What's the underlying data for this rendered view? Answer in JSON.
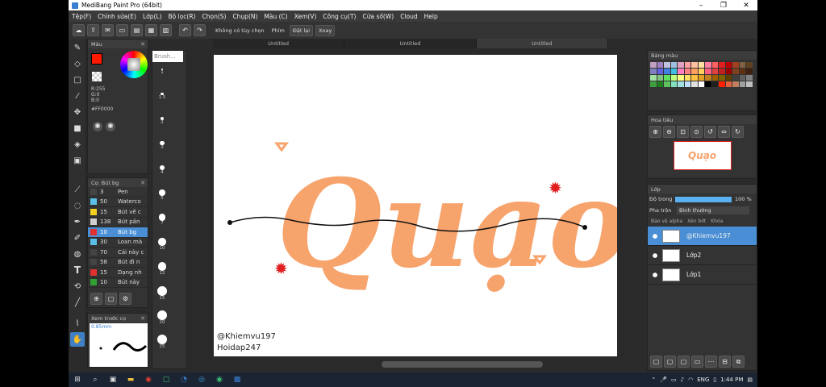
{
  "window": {
    "title": "MediBang Paint Pro (64bit)"
  },
  "menu": [
    "Tệp(F)",
    "Chỉnh sửa(E)",
    "Lớp(L)",
    "Bộ lọc(R)",
    "Chọn(S)",
    "Chụp(N)",
    "Màu (C)",
    "Xem(V)",
    "Công cụ(T)",
    "Cửa số(W)",
    "Cloud",
    "Help"
  ],
  "toolbar": {
    "options_label": "Không có tùy chọn",
    "key_label": "Phím",
    "reset_label": "Đặt lại",
    "rotate_label": "Xoay"
  },
  "tabs": [
    "Untitled",
    "Untitled",
    "Untitled"
  ],
  "color_panel": {
    "title": "Màu",
    "r": "R:255",
    "g": "G:0",
    "b": "B:0",
    "hex": "#FF0000",
    "primary": "#ff1a00",
    "secondary": "#ffffff"
  },
  "brush_panel": {
    "title": "Cọ: Bút bg",
    "items": [
      {
        "size": "3",
        "name": "Pen",
        "color": "#444444"
      },
      {
        "size": "50",
        "name": "Waterco",
        "color": "#5bc0e8"
      },
      {
        "size": "15",
        "name": "Bút vẽ c",
        "color": "#f0d020"
      },
      {
        "size": "138",
        "name": "Bút pấn",
        "color": "#d0d0d0"
      },
      {
        "size": "10",
        "name": "Bút bg",
        "color": "#e03030",
        "selected": true
      },
      {
        "size": "30",
        "name": "Loan mà",
        "color": "#5bc0e8"
      },
      {
        "size": "70",
        "name": "Cái này c",
        "color": "#444444"
      },
      {
        "size": "58",
        "name": "Bút đi n",
        "color": "#444444"
      },
      {
        "size": "15",
        "name": "Dạng nh",
        "color": "#e03030"
      },
      {
        "size": "10",
        "name": "Bút này",
        "color": "#30a030"
      }
    ]
  },
  "preview_panel": {
    "title": "Xem trước cọ",
    "size": "0.85mm"
  },
  "brush_size_panel": {
    "title": "Brush...",
    "ticks": [
      "1",
      "1.5",
      "2",
      "3",
      "4",
      "5",
      "7",
      "10",
      "12",
      "15",
      "20",
      "25"
    ]
  },
  "canvas": {
    "main_text": "Quạo",
    "credit1": "@Khiemvu197",
    "credit2": "Hoidap247",
    "text_color": "#f7a36c"
  },
  "palette_panel": {
    "title": "Bảng màu",
    "colors": [
      "#c0a0c0",
      "#a080c0",
      "#c0c0e0",
      "#a0c0e0",
      "#e0a0c0",
      "#ffa0a0",
      "#ffc0a0",
      "#ffe0a0",
      "#ff80a0",
      "#ff6060",
      "#e02020",
      "#c00000",
      "#a04020",
      "#806040",
      "#604020",
      "#8080c0",
      "#6060e0",
      "#4080e0",
      "#40c0e0",
      "#ff80c0",
      "#ff8080",
      "#ffa060",
      "#ffd060",
      "#ff6080",
      "#e04040",
      "#c02020",
      "#a00000",
      "#804020",
      "#603010",
      "#402010",
      "#a0e0a0",
      "#80c080",
      "#60e060",
      "#c0ff80",
      "#ffff80",
      "#ffe060",
      "#ffc040",
      "#e0a020",
      "#c08020",
      "#a06000",
      "#806000",
      "#604000",
      "#404040",
      "#606060",
      "#808080",
      "#40a040",
      "#208020",
      "#60c060",
      "#80e0c0",
      "#a0e0e0",
      "#c0e0ff",
      "#e0e0e0",
      "#ffffff",
      "#000000",
      "#202020",
      "#ff2000",
      "#e06040",
      "#c08060",
      "#a0a0a0",
      "#c0c0c0"
    ]
  },
  "navigator_panel": {
    "title": "Hoa tiêu"
  },
  "layer_panel": {
    "title": "Lớp",
    "opacity_label": "Độ trong",
    "opacity_value": "100 %",
    "blend_label": "Pha trộn",
    "blend_value": "Bình thường",
    "protect_alpha": "Bảo vệ alpha",
    "clip": "Xén bớt",
    "lock": "Khóa",
    "layers": [
      {
        "name": "@Khiemvu197",
        "selected": true
      },
      {
        "name": "Lớp2"
      },
      {
        "name": "Lớp1"
      }
    ]
  },
  "taskbar": {
    "lang": "ENG",
    "time": "1:44 PM"
  }
}
